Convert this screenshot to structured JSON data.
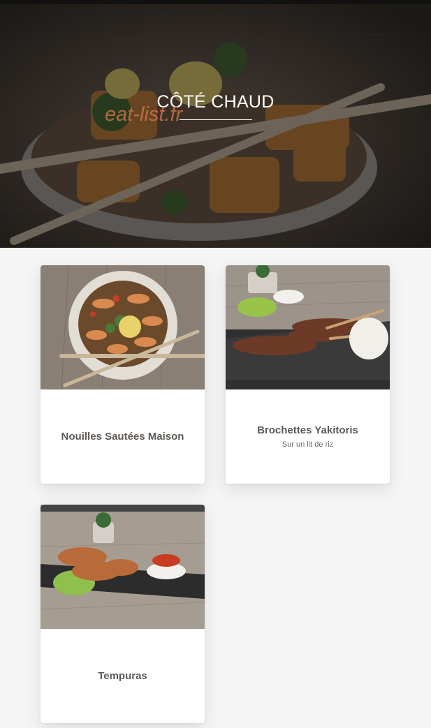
{
  "hero": {
    "title": "CÔTÉ CHAUD",
    "watermark": "eat-list.fr"
  },
  "items": [
    {
      "name": "Nouilles Sautées Maison",
      "description": ""
    },
    {
      "name": "Brochettes Yakitoris",
      "description": "Sur un lit de riz"
    },
    {
      "name": "Tempuras",
      "description": ""
    }
  ]
}
